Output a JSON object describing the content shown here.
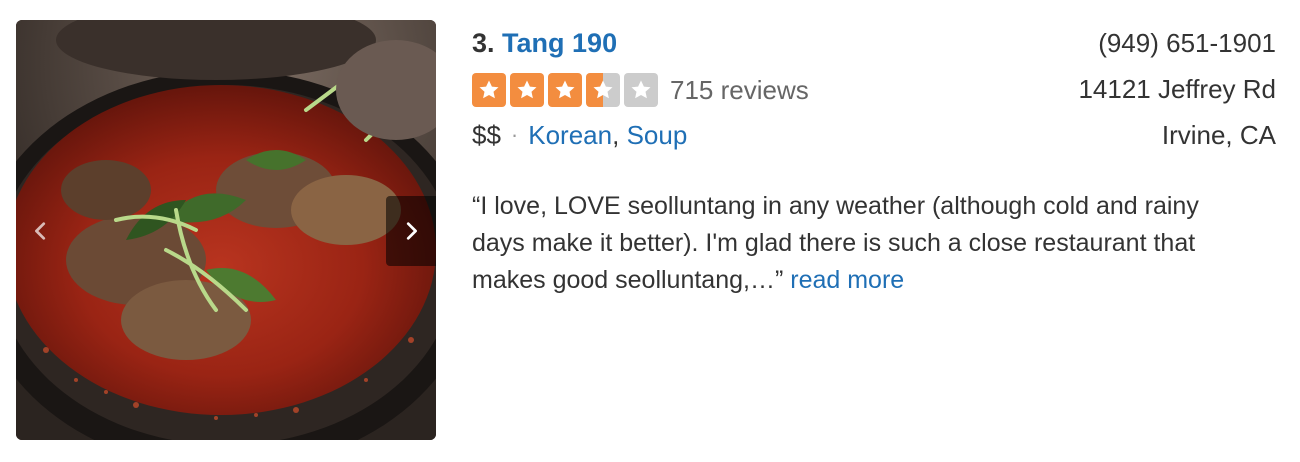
{
  "listing": {
    "rank": "3.",
    "name": "Tang 190",
    "rating": 3.5,
    "rating_max": 5,
    "review_count_text": "715 reviews",
    "price": "$$",
    "separator": "·",
    "categories": [
      "Korean",
      "Soup"
    ],
    "category_separator": ",",
    "snippet": "“I love, LOVE seolluntang in any weather (although cold and rainy days make it better). I'm glad there is such a close restaurant that makes good seolluntang,…”",
    "read_more": "read more"
  },
  "contact": {
    "phone": "(949) 651-1901",
    "street": "14121 Jeffrey Rd",
    "city": "Irvine, CA"
  },
  "photo": {
    "icons": {
      "prev": "chevron-left-icon",
      "next": "chevron-right-icon"
    }
  },
  "colors": {
    "star_filled": "#f38d3f",
    "star_empty": "#cccccc",
    "link": "#1f6fb5"
  }
}
